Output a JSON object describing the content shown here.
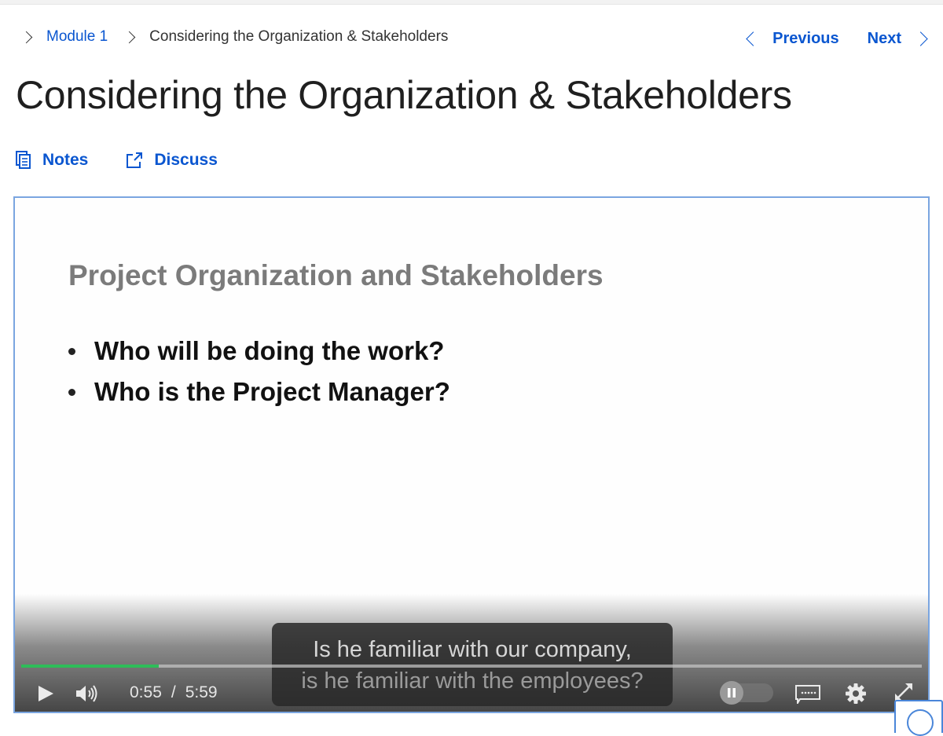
{
  "breadcrumb": {
    "items": [
      {
        "label": "Module 1",
        "link": true
      },
      {
        "label": "Considering the Organization & Stakeholders",
        "link": false
      }
    ]
  },
  "nav": {
    "previous_label": "Previous",
    "next_label": "Next"
  },
  "page": {
    "title": "Considering the Organization & Stakeholders"
  },
  "actions": [
    {
      "label": "Notes",
      "icon": "notes-icon"
    },
    {
      "label": "Discuss",
      "icon": "external-link-icon"
    }
  ],
  "video": {
    "slide": {
      "title": "Project Organization and Stakeholders",
      "bullets": [
        "Who will be doing the work?",
        "Who is the Project Manager?"
      ]
    },
    "caption": {
      "line1": "Is he familiar with our company,",
      "line2": "is he familiar with the employees?"
    },
    "current_time": "0:55",
    "time_separator": "/",
    "duration": "5:59",
    "progress_fraction": 0.153,
    "progress_color": "#2ebd59",
    "controls": [
      "play-icon",
      "volume-icon",
      "pause-toggle",
      "captions-icon",
      "settings-gear-icon",
      "fullscreen-icon"
    ]
  },
  "colors": {
    "link": "#0a56d0",
    "player_border": "#7aa5e0"
  }
}
